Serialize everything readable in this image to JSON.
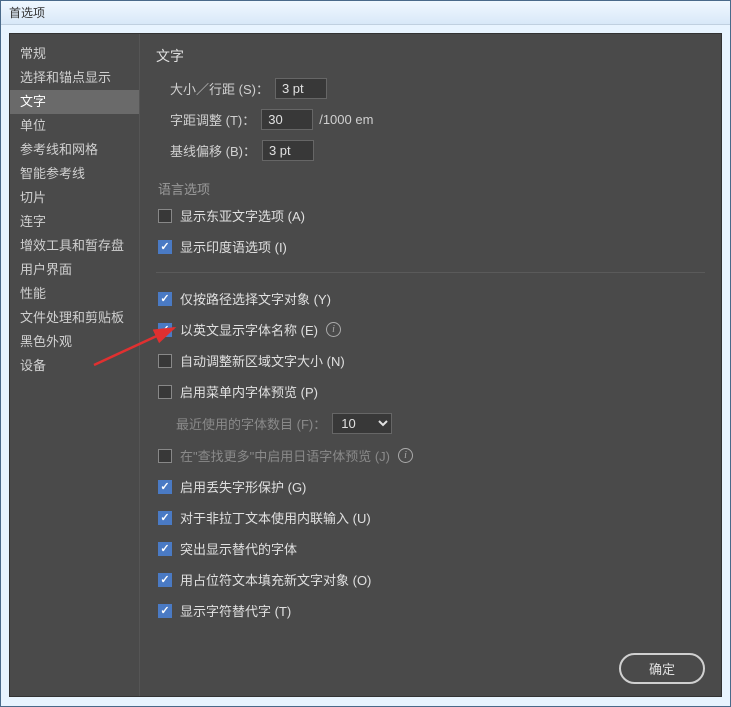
{
  "window": {
    "title": "首选项"
  },
  "sidebar": {
    "items": [
      {
        "label": "常规"
      },
      {
        "label": "选择和锚点显示"
      },
      {
        "label": "文字"
      },
      {
        "label": "单位"
      },
      {
        "label": "参考线和网格"
      },
      {
        "label": "智能参考线"
      },
      {
        "label": "切片"
      },
      {
        "label": "连字"
      },
      {
        "label": "增效工具和暂存盘"
      },
      {
        "label": "用户界面"
      },
      {
        "label": "性能"
      },
      {
        "label": "文件处理和剪贴板"
      },
      {
        "label": "黑色外观"
      },
      {
        "label": "设备"
      }
    ],
    "selected_index": 2
  },
  "content": {
    "section_title": "文字",
    "size_leading": {
      "label": "大小／行距 (S)：",
      "value": "3 pt"
    },
    "tracking": {
      "label": "字距调整 (T)：",
      "value": "30",
      "unit": "/1000 em"
    },
    "baseline": {
      "label": "基线偏移 (B)：",
      "value": "3 pt"
    },
    "lang_section": "语言选项",
    "check_east_asian": {
      "label": "显示东亚文字选项 (A)",
      "checked": false
    },
    "check_indic": {
      "label": "显示印度语选项 (I)",
      "checked": true
    },
    "check_path_only": {
      "label": "仅按路径选择文字对象 (Y)",
      "checked": true
    },
    "check_english_font": {
      "label": "以英文显示字体名称 (E)",
      "checked": true
    },
    "check_auto_size": {
      "label": "自动调整新区域文字大小 (N)",
      "checked": false
    },
    "check_menu_preview": {
      "label": "启用菜单内字体预览 (P)",
      "checked": false
    },
    "recent_fonts": {
      "label": "最近使用的字体数目 (F)：",
      "value": "10"
    },
    "check_japanese_preview": {
      "label": "在\"查找更多\"中启用日语字体预览 (J)",
      "checked": false
    },
    "check_missing_glyph": {
      "label": "启用丢失字形保护 (G)",
      "checked": true
    },
    "check_inline_input": {
      "label": "对于非拉丁文本使用内联输入 (U)",
      "checked": true
    },
    "check_highlight_alt": {
      "label": "突出显示替代的字体",
      "checked": true
    },
    "check_placeholder": {
      "label": "用占位符文本填充新文字对象 (O)",
      "checked": true
    },
    "check_show_alt_glyph": {
      "label": "显示字符替代字 (T)",
      "checked": true
    }
  },
  "buttons": {
    "ok": "确定"
  }
}
